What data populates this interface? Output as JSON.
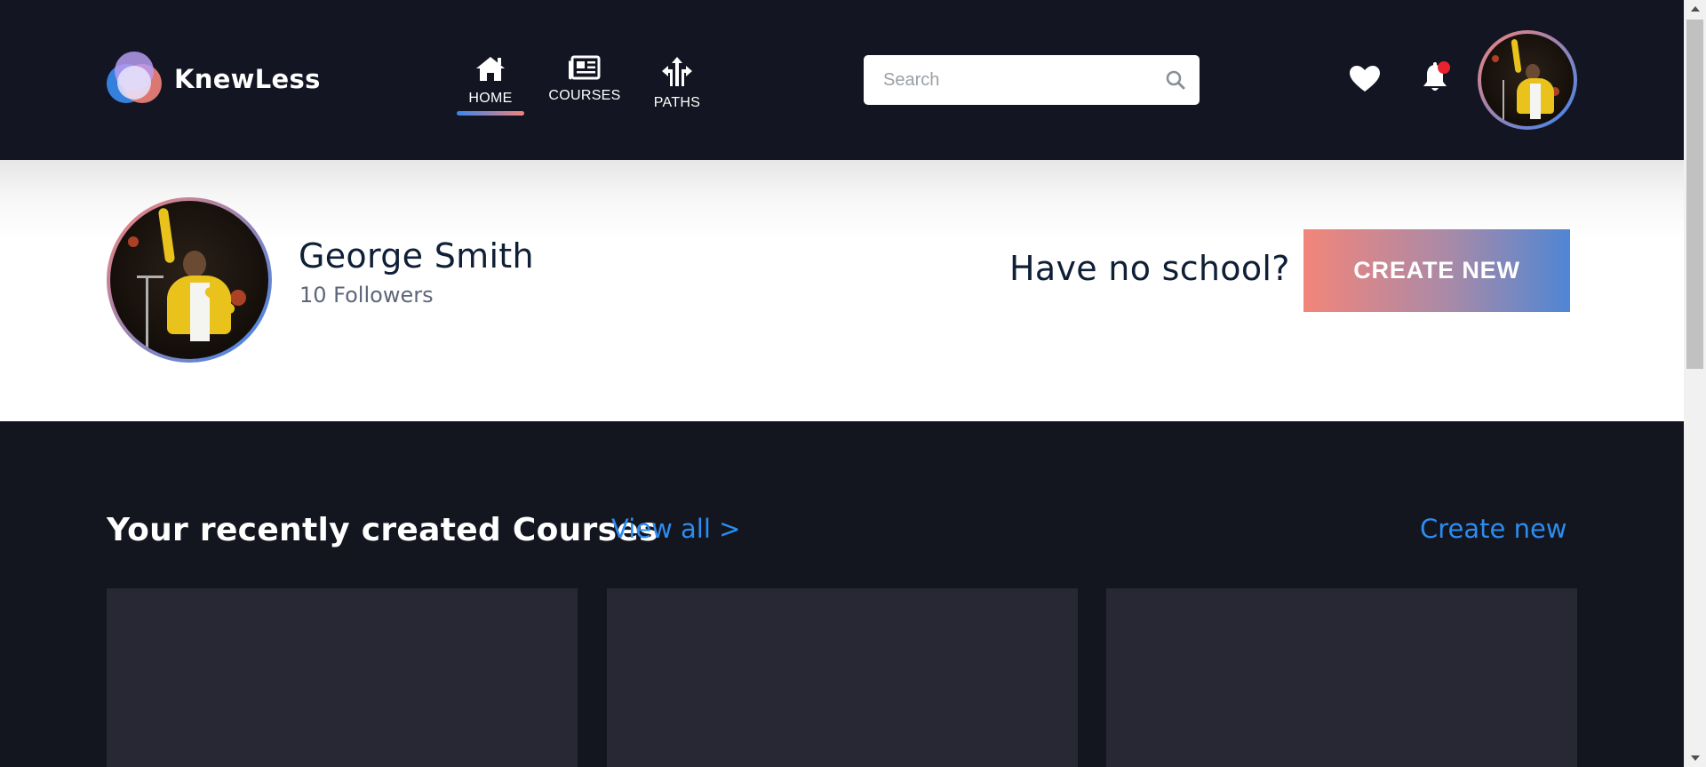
{
  "brand": {
    "name": "KnewLess"
  },
  "nav": {
    "items": [
      {
        "label": "HOME",
        "icon": "home-icon",
        "active": true
      },
      {
        "label": "COURSES",
        "icon": "newspaper-icon",
        "active": false
      },
      {
        "label": "PATHS",
        "icon": "signpost-icon",
        "active": false
      }
    ]
  },
  "search": {
    "placeholder": "Search",
    "value": ""
  },
  "header_icons": {
    "favorites": "heart-icon",
    "notifications": "bell-icon",
    "notification_dot": true
  },
  "profile": {
    "name": "George Smith",
    "followers": "10 Followers",
    "prompt": "Have no school?",
    "create_button": "CREATE NEW"
  },
  "courses_section": {
    "title": "Your recently created Courses",
    "view_all": "View all >",
    "create_link": "Create new",
    "cards": [
      {},
      {},
      {}
    ]
  },
  "colors": {
    "header_bg": "#131522",
    "accent_blue": "#2d8cf0",
    "gradient_start": "#f3837a",
    "gradient_end": "#3a86f0",
    "card_bg": "#282834",
    "notification_dot": "#e8232f"
  }
}
